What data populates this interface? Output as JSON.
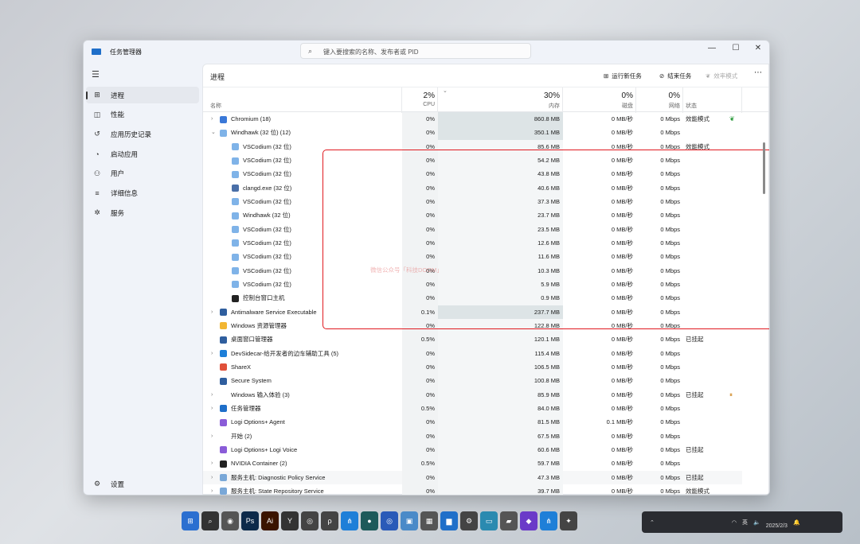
{
  "window": {
    "title": "任务管理器",
    "search_placeholder": "键入要搜索的名称、发布者或 PID"
  },
  "sidebar": {
    "items": [
      {
        "label": "进程",
        "icon": "processes-icon"
      },
      {
        "label": "性能",
        "icon": "performance-icon"
      },
      {
        "label": "应用历史记录",
        "icon": "history-icon"
      },
      {
        "label": "启动应用",
        "icon": "startup-icon"
      },
      {
        "label": "用户",
        "icon": "users-icon"
      },
      {
        "label": "详细信息",
        "icon": "details-icon"
      },
      {
        "label": "服务",
        "icon": "services-icon"
      }
    ],
    "settings": "设置"
  },
  "main": {
    "title": "进程",
    "run_new_task": "运行新任务",
    "end_task": "结束任务",
    "efficiency_mode": "效率模式",
    "more": "⋯"
  },
  "columns": {
    "name": "名称",
    "cpu_pct": "2%",
    "cpu": "CPU",
    "mem_pct": "30%",
    "mem": "内存",
    "disk_pct": "0%",
    "disk": "磁盘",
    "net_pct": "0%",
    "net": "网络",
    "status": "状态"
  },
  "rows": [
    {
      "name": "Chromium (18)",
      "cpu": "0%",
      "mem": "860.8 MB",
      "disk": "0 MB/秒",
      "net": "0 Mbps",
      "status": "效能模式",
      "exp": "›",
      "color": "#3a78d8",
      "hi": 1,
      "sicon": "leaf"
    },
    {
      "name": "Windhawk (32 位) (12)",
      "cpu": "0%",
      "mem": "350.1 MB",
      "disk": "0 MB/秒",
      "net": "0 Mbps",
      "status": "",
      "exp": "⌄",
      "color": "#7fb3e8",
      "hi": 1
    },
    {
      "name": "VSCodium (32 位)",
      "cpu": "0%",
      "mem": "85.6 MB",
      "disk": "0 MB/秒",
      "net": "0 Mbps",
      "status": "效能模式",
      "child": 1,
      "color": "#7fb3e8"
    },
    {
      "name": "VSCodium (32 位)",
      "cpu": "0%",
      "mem": "54.2 MB",
      "disk": "0 MB/秒",
      "net": "0 Mbps",
      "status": "",
      "child": 1,
      "color": "#7fb3e8"
    },
    {
      "name": "VSCodium (32 位)",
      "cpu": "0%",
      "mem": "43.8 MB",
      "disk": "0 MB/秒",
      "net": "0 Mbps",
      "status": "",
      "child": 1,
      "color": "#7fb3e8"
    },
    {
      "name": "clangd.exe (32 位)",
      "cpu": "0%",
      "mem": "40.6 MB",
      "disk": "0 MB/秒",
      "net": "0 Mbps",
      "status": "",
      "child": 1,
      "color": "#4a6fa8"
    },
    {
      "name": "VSCodium (32 位)",
      "cpu": "0%",
      "mem": "37.3 MB",
      "disk": "0 MB/秒",
      "net": "0 Mbps",
      "status": "",
      "child": 1,
      "color": "#7fb3e8"
    },
    {
      "name": "Windhawk (32 位)",
      "cpu": "0%",
      "mem": "23.7 MB",
      "disk": "0 MB/秒",
      "net": "0 Mbps",
      "status": "",
      "child": 1,
      "color": "#7fb3e8"
    },
    {
      "name": "VSCodium (32 位)",
      "cpu": "0%",
      "mem": "23.5 MB",
      "disk": "0 MB/秒",
      "net": "0 Mbps",
      "status": "",
      "child": 1,
      "color": "#7fb3e8"
    },
    {
      "name": "VSCodium (32 位)",
      "cpu": "0%",
      "mem": "12.6 MB",
      "disk": "0 MB/秒",
      "net": "0 Mbps",
      "status": "",
      "child": 1,
      "color": "#7fb3e8"
    },
    {
      "name": "VSCodium (32 位)",
      "cpu": "0%",
      "mem": "11.6 MB",
      "disk": "0 MB/秒",
      "net": "0 Mbps",
      "status": "",
      "child": 1,
      "color": "#7fb3e8"
    },
    {
      "name": "VSCodium (32 位)",
      "cpu": "0%",
      "mem": "10.3 MB",
      "disk": "0 MB/秒",
      "net": "0 Mbps",
      "status": "",
      "child": 1,
      "color": "#7fb3e8"
    },
    {
      "name": "VSCodium (32 位)",
      "cpu": "0%",
      "mem": "5.9 MB",
      "disk": "0 MB/秒",
      "net": "0 Mbps",
      "status": "",
      "child": 1,
      "color": "#7fb3e8"
    },
    {
      "name": "控制台窗口主机",
      "cpu": "0%",
      "mem": "0.9 MB",
      "disk": "0 MB/秒",
      "net": "0 Mbps",
      "status": "",
      "child": 1,
      "color": "#222"
    },
    {
      "name": "Antimalware Service Executable",
      "cpu": "0.1%",
      "mem": "237.7 MB",
      "disk": "0 MB/秒",
      "net": "0 Mbps",
      "status": "",
      "exp": "›",
      "color": "#2f5e9e",
      "hi": 1
    },
    {
      "name": "Windows 资源管理器",
      "cpu": "0%",
      "mem": "122.8 MB",
      "disk": "0 MB/秒",
      "net": "0 Mbps",
      "status": "",
      "color": "#f2b632"
    },
    {
      "name": "桌面窗口管理器",
      "cpu": "0.5%",
      "mem": "120.1 MB",
      "disk": "0 MB/秒",
      "net": "0 Mbps",
      "status": "已挂起",
      "color": "#2f5e9e"
    },
    {
      "name": "DevSidecar-给开发者的边车辅助工具 (5)",
      "cpu": "0%",
      "mem": "115.4 MB",
      "disk": "0 MB/秒",
      "net": "0 Mbps",
      "status": "",
      "exp": "›",
      "color": "#1e7fd8"
    },
    {
      "name": "ShareX",
      "cpu": "0%",
      "mem": "106.5 MB",
      "disk": "0 MB/秒",
      "net": "0 Mbps",
      "status": "",
      "color": "#e0503a"
    },
    {
      "name": "Secure System",
      "cpu": "0%",
      "mem": "100.8 MB",
      "disk": "0 MB/秒",
      "net": "0 Mbps",
      "status": "",
      "color": "#2f5e9e"
    },
    {
      "name": "Windows 输入体验 (3)",
      "cpu": "0%",
      "mem": "85.9 MB",
      "disk": "0 MB/秒",
      "net": "0 Mbps",
      "status": "已挂起",
      "exp": "›",
      "color": "transparent",
      "sicon": "pause"
    },
    {
      "name": "任务管理器",
      "cpu": "0.5%",
      "mem": "84.0 MB",
      "disk": "0 MB/秒",
      "net": "0 Mbps",
      "status": "",
      "exp": "›",
      "color": "#1f6fc9"
    },
    {
      "name": "Logi Options+ Agent",
      "cpu": "0%",
      "mem": "81.5 MB",
      "disk": "0.1 MB/秒",
      "net": "0 Mbps",
      "status": "",
      "color": "#8a5cd8"
    },
    {
      "name": "开始 (2)",
      "cpu": "0%",
      "mem": "67.5 MB",
      "disk": "0 MB/秒",
      "net": "0 Mbps",
      "status": "",
      "exp": "›",
      "color": "transparent"
    },
    {
      "name": "Logi Options+ Logi Voice",
      "cpu": "0%",
      "mem": "60.6 MB",
      "disk": "0 MB/秒",
      "net": "0 Mbps",
      "status": "已挂起",
      "color": "#8a5cd8"
    },
    {
      "name": "NVIDIA Container (2)",
      "cpu": "0.5%",
      "mem": "59.7 MB",
      "disk": "0 MB/秒",
      "net": "0 Mbps",
      "status": "",
      "exp": "›",
      "color": "#222"
    },
    {
      "name": "服务主机: Diagnostic Policy Service",
      "cpu": "0%",
      "mem": "47.3 MB",
      "disk": "0 MB/秒",
      "net": "0 Mbps",
      "status": "已挂起",
      "exp": "›",
      "color": "#7aa8d8",
      "alt": 1
    },
    {
      "name": "服务主机: State Repository Service",
      "cpu": "0%",
      "mem": "39.7 MB",
      "disk": "0 MB/秒",
      "net": "0 Mbps",
      "status": "效能模式",
      "exp": "›",
      "color": "#7aa8d8"
    }
  ],
  "watermark": "微信公众号「科技DOOM」",
  "tray": {
    "date": "2025/2/3",
    "ime": "英"
  }
}
